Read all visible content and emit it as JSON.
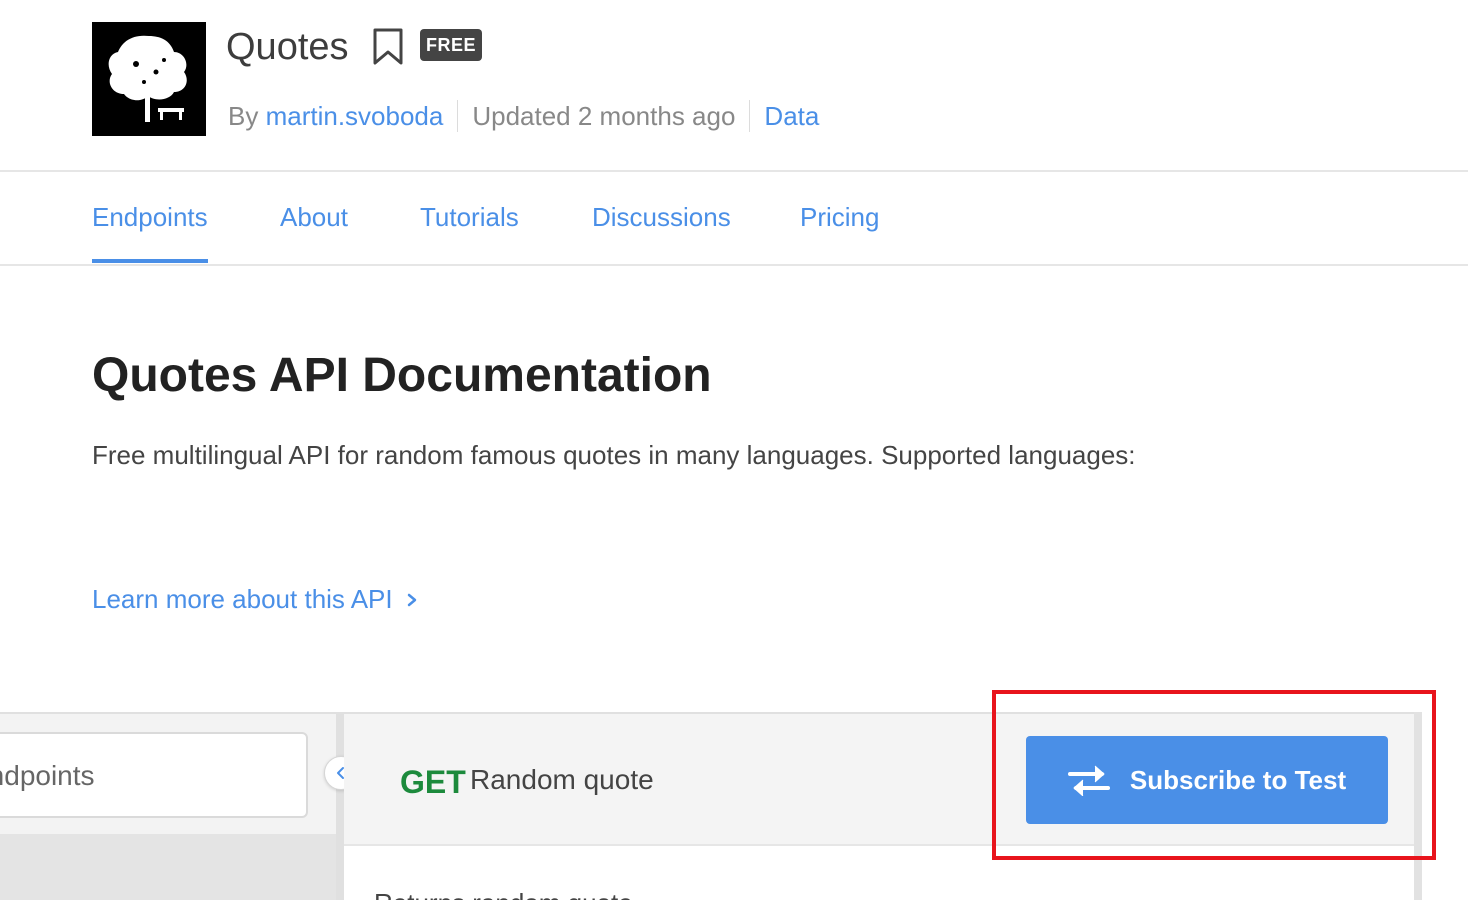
{
  "header": {
    "title": "Quotes",
    "badge": "FREE",
    "by_label": "By",
    "author": "martin.svoboda",
    "updated": "Updated 2 months ago",
    "category": "Data"
  },
  "tabs": [
    {
      "label": "Endpoints",
      "active": true
    },
    {
      "label": "About",
      "active": false
    },
    {
      "label": "Tutorials",
      "active": false
    },
    {
      "label": "Discussions",
      "active": false
    },
    {
      "label": "Pricing",
      "active": false
    }
  ],
  "doc": {
    "title": "Quotes API Documentation",
    "description": "Free multilingual API for random famous quotes in many languages. Supported languages:",
    "learn_more": "Learn more about this API"
  },
  "sidebar": {
    "search_text": "Endpoints"
  },
  "endpoint": {
    "method": "GET",
    "name": "Random quote",
    "subscribe_label": "Subscribe to Test",
    "body_text": "Returns random quote"
  },
  "colors": {
    "accent": "#4a8fe7",
    "method_get": "#1c8a3c",
    "highlight": "#e8141c",
    "badge_bg": "#444444"
  },
  "icons": {
    "bookmark": "bookmark-outline-icon",
    "chevron": "chevron-right-icon",
    "collapse": "chevron-left-icon",
    "subscribe": "swap-arrows-icon"
  }
}
